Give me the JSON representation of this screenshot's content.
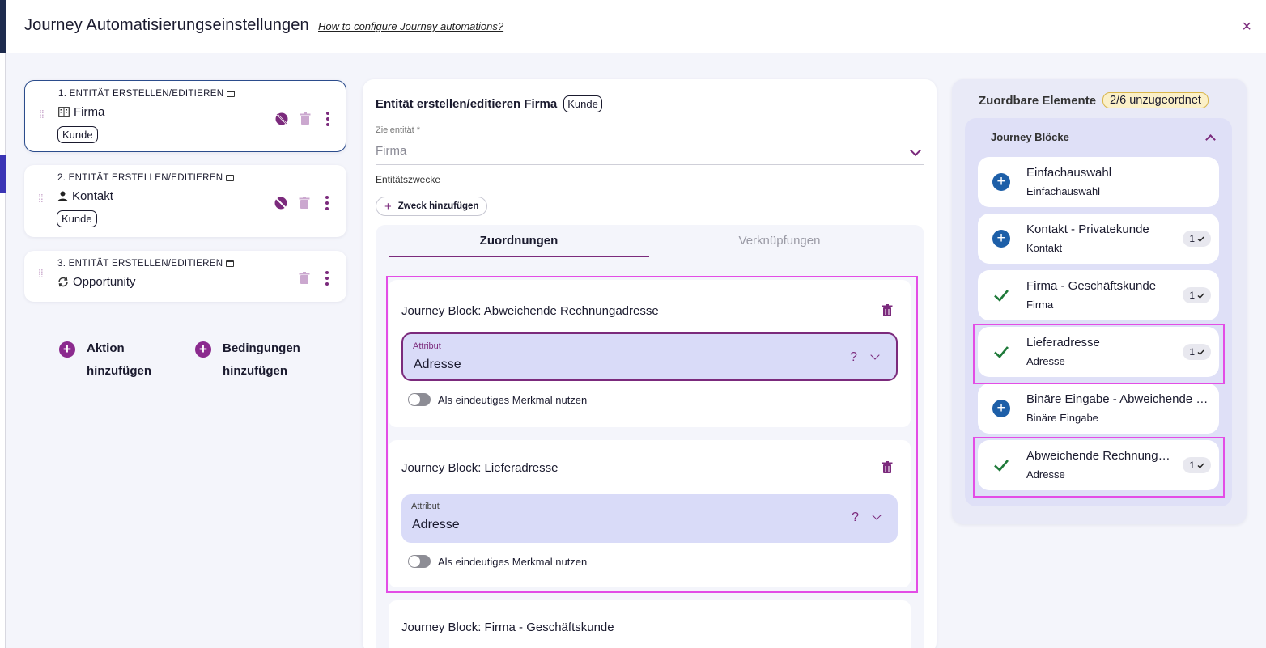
{
  "dialog": {
    "title": "Journey Automatisierungseinstellungen",
    "help_link": "How to configure Journey automations?",
    "close_icon": "×"
  },
  "steps": [
    {
      "label": "1. ENTITÄT ERSTELLEN/EDITIEREN",
      "entity": "Firma",
      "entity_icon": "building-icon",
      "chip": "Kunde"
    },
    {
      "label": "2. ENTITÄT ERSTELLEN/EDITIEREN",
      "entity": "Kontakt",
      "entity_icon": "person-icon",
      "chip": "Kunde"
    },
    {
      "label": "3. ENTITÄT ERSTELLEN/EDITIEREN",
      "entity": "Opportunity",
      "entity_icon": "sync-icon",
      "chip": ""
    }
  ],
  "left_actions": {
    "action_line1": "Aktion",
    "action_line2": "hinzufügen",
    "conditions_line1": "Bedingungen",
    "conditions_line2": "hinzufügen"
  },
  "middle": {
    "title": "Entität erstellen/editieren Firma",
    "title_chip": "Kunde",
    "target_label": "Zielentität *",
    "target_value": "Firma",
    "purposes_label": "Entitätszwecke",
    "add_purpose": "Zweck hinzufügen",
    "tabs": {
      "active": "Zuordnungen",
      "inactive": "Verknüpfungen"
    },
    "blocks": [
      {
        "title": "Journey Block: Abweichende Rechnungadresse",
        "attr_label": "Attribut",
        "attr_value": "Adresse",
        "help": "?",
        "toggle_label": "Als eindeutiges Merkmal nutzen"
      },
      {
        "title": "Journey Block: Lieferadresse",
        "attr_label": "Attribut",
        "attr_value": "Adresse",
        "help": "?",
        "toggle_label": "Als eindeutiges Merkmal nutzen"
      },
      {
        "title": "Journey Block: Firma - Geschäftskunde"
      }
    ]
  },
  "right": {
    "title": "Zuordbare Elemente",
    "badge": "2/6 unzugeordnet",
    "group_title": "Journey Blöcke",
    "items": [
      {
        "title": "Einfachauswahl",
        "subtitle": "Einfachauswahl",
        "state": "add",
        "count": ""
      },
      {
        "title": "Kontakt - Privatekunde",
        "subtitle": "Kontakt",
        "state": "add",
        "count": "1"
      },
      {
        "title": "Firma - Geschäftskunde",
        "subtitle": "Firma",
        "state": "mapped",
        "count": "1"
      },
      {
        "title": "Lieferadresse",
        "subtitle": "Adresse",
        "state": "mapped",
        "count": "1"
      },
      {
        "title": "Binäre Eingabe - Abweichende Rechnungsadresse",
        "subtitle": "Binäre Eingabe",
        "state": "add",
        "count": ""
      },
      {
        "title": "Abweichende Rechnungsadresse",
        "subtitle": "Adresse",
        "state": "mapped",
        "count": "1"
      }
    ]
  },
  "colors": {
    "accent": "#7b2a7c",
    "primary_blue": "#1d5fa8",
    "check_green": "#1f7a3a",
    "highlight": "#e34de6",
    "badge_bg": "#fbf0c8"
  }
}
